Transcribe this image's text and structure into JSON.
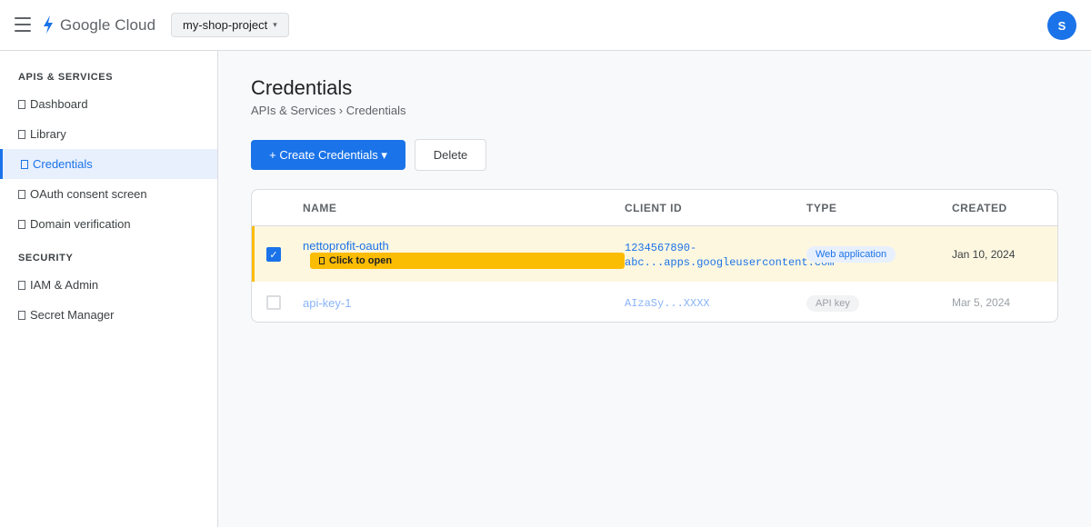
{
  "header": {
    "logo_text": "Google Cloud",
    "project": "my-shop-project",
    "project_chevron": "▾",
    "avatar_initial": "S"
  },
  "sidebar": {
    "sections": [
      {
        "title": "APIS & SERVICES",
        "items": [
          {
            "label": "Dashboard",
            "icon": "dashboard-icon"
          },
          {
            "label": "Library",
            "icon": "library-icon"
          },
          {
            "label": "Credentials",
            "icon": "credentials-icon",
            "active": true
          },
          {
            "label": "OAuth consent screen",
            "icon": "oauth-icon"
          },
          {
            "label": "Domain verification",
            "icon": "domain-icon"
          }
        ]
      },
      {
        "title": "SECURITY",
        "items": [
          {
            "label": "IAM & Admin",
            "icon": "iam-icon"
          },
          {
            "label": "Secret Manager",
            "icon": "secret-icon"
          }
        ]
      }
    ]
  },
  "main": {
    "title": "Credentials",
    "breadcrumb": "APIs & Services › Credentials",
    "create_button": "+ Create Credentials ▾",
    "delete_button": "Delete",
    "table": {
      "headers": [
        "NAME",
        "CLIENT ID",
        "TYPE",
        "CREATED"
      ],
      "rows": [
        {
          "checked": true,
          "name": "nettoprofit-oauth",
          "client_id_line1": "1234567890-",
          "client_id_line2": "abc...apps.googleusercontent.com",
          "type": "Web application",
          "created": "Jan 10, 2024",
          "tooltip": "Click to open"
        },
        {
          "checked": false,
          "name": "api-key-1",
          "client_id_line1": "AIzaSy...XXXX",
          "type": "API key",
          "created": "Mar 5, 2024"
        }
      ]
    }
  },
  "colors": {
    "accent": "#1a73e8",
    "highlight_row": "#fef7e0",
    "highlight_border": "#fbbc04"
  }
}
